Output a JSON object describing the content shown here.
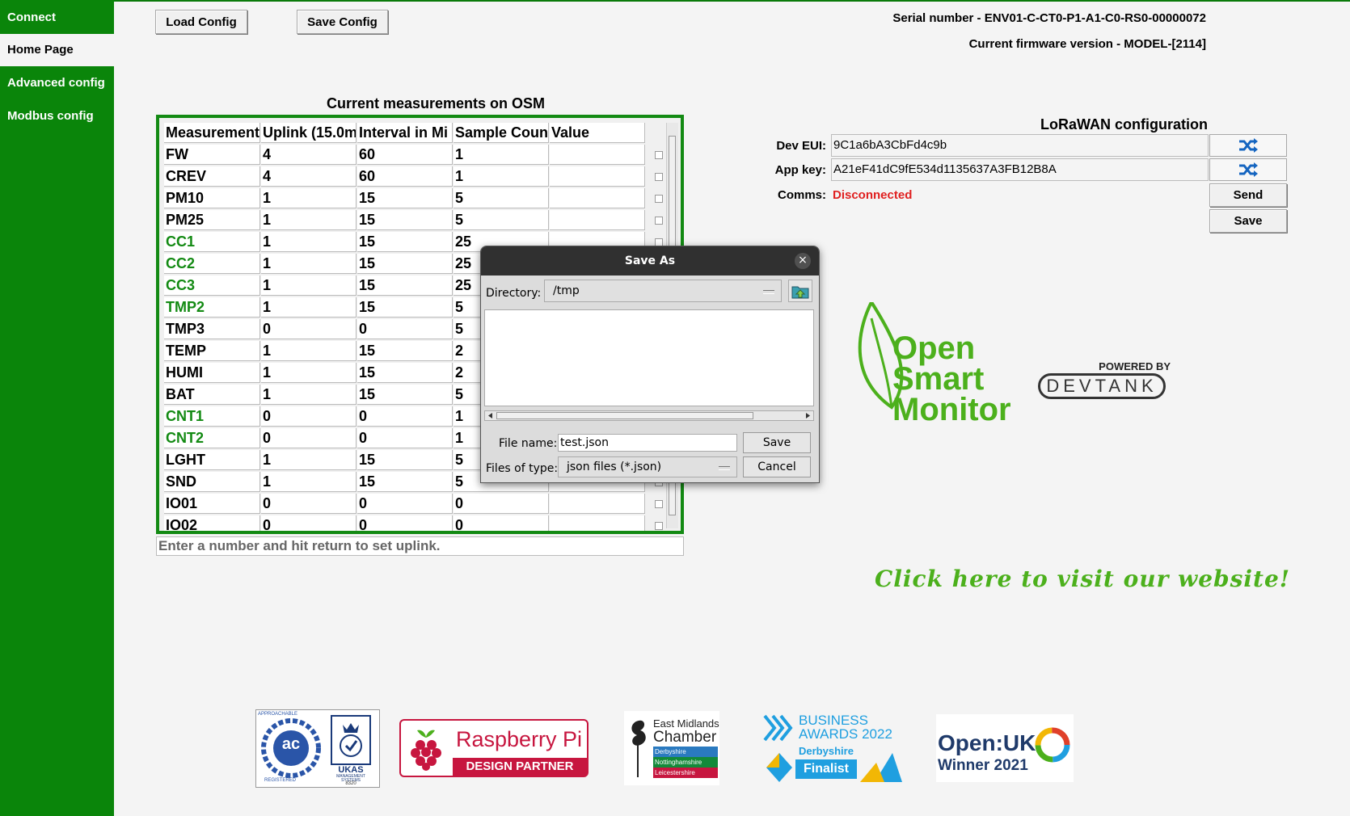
{
  "sidebar": {
    "items": [
      {
        "label": "Connect",
        "active": false
      },
      {
        "label": "Home Page",
        "active": true
      },
      {
        "label": "Advanced config",
        "active": false
      },
      {
        "label": "Modbus config",
        "active": false
      }
    ]
  },
  "toolbar": {
    "load_label": "Load Config",
    "save_label": "Save Config"
  },
  "device": {
    "serial": "Serial number - ENV01-C-CT0-P1-A1-C0-RS0-00000072",
    "firmware": "Current firmware version - MODEL-[2114]"
  },
  "measurements": {
    "title": "Current measurements on OSM",
    "columns": [
      "Measurement",
      "Uplink (15.0m",
      "Interval in Mi",
      "Sample Coun",
      "Value"
    ],
    "rows": [
      {
        "name": "FW",
        "uplink": "4",
        "interval": "60",
        "samples": "1",
        "value": "",
        "green": false
      },
      {
        "name": "CREV",
        "uplink": "4",
        "interval": "60",
        "samples": "1",
        "value": "",
        "green": false
      },
      {
        "name": "PM10",
        "uplink": "1",
        "interval": "15",
        "samples": "5",
        "value": "",
        "green": false
      },
      {
        "name": "PM25",
        "uplink": "1",
        "interval": "15",
        "samples": "5",
        "value": "",
        "green": false
      },
      {
        "name": "CC1",
        "uplink": "1",
        "interval": "15",
        "samples": "25",
        "value": "",
        "green": true
      },
      {
        "name": "CC2",
        "uplink": "1",
        "interval": "15",
        "samples": "25",
        "value": "",
        "green": true
      },
      {
        "name": "CC3",
        "uplink": "1",
        "interval": "15",
        "samples": "25",
        "value": "",
        "green": true
      },
      {
        "name": "TMP2",
        "uplink": "1",
        "interval": "15",
        "samples": "5",
        "value": "",
        "green": true
      },
      {
        "name": "TMP3",
        "uplink": "0",
        "interval": "0",
        "samples": "5",
        "value": "",
        "green": false
      },
      {
        "name": "TEMP",
        "uplink": "1",
        "interval": "15",
        "samples": "2",
        "value": "",
        "green": false
      },
      {
        "name": "HUMI",
        "uplink": "1",
        "interval": "15",
        "samples": "2",
        "value": "",
        "green": false
      },
      {
        "name": "BAT",
        "uplink": "1",
        "interval": "15",
        "samples": "5",
        "value": "",
        "green": false
      },
      {
        "name": "CNT1",
        "uplink": "0",
        "interval": "0",
        "samples": "1",
        "value": "",
        "green": true
      },
      {
        "name": "CNT2",
        "uplink": "0",
        "interval": "0",
        "samples": "1",
        "value": "",
        "green": true
      },
      {
        "name": "LGHT",
        "uplink": "1",
        "interval": "15",
        "samples": "5",
        "value": "",
        "green": false
      },
      {
        "name": "SND",
        "uplink": "1",
        "interval": "15",
        "samples": "5",
        "value": "",
        "green": false
      },
      {
        "name": "IO01",
        "uplink": "0",
        "interval": "0",
        "samples": "0",
        "value": "",
        "green": false
      },
      {
        "name": "IO02",
        "uplink": "0",
        "interval": "0",
        "samples": "0",
        "value": "",
        "green": false
      }
    ],
    "hint": "Enter a number and hit return to set uplink."
  },
  "lorawan": {
    "title": "LoRaWAN configuration",
    "dev_eui_label": "Dev EUI:",
    "dev_eui": "9C1a6bA3CbFd4c9b",
    "app_key_label": "App key:",
    "app_key": "A21eF41dC9fE534d1135637A3FB12B8A",
    "comms_label": "Comms:",
    "comms_status": "Disconnected",
    "send_label": "Send",
    "save_label": "Save",
    "status_color": "#e02020"
  },
  "dialog": {
    "title": "Save As",
    "close_glyph": "×",
    "directory_label": "Directory:",
    "directory": "/tmp",
    "filename_label": "File name:",
    "filename": "test.json",
    "filetype_label": "Files of type:",
    "filetype": "json files (*.json)",
    "save_label": "Save",
    "cancel_label": "Cancel"
  },
  "branding": {
    "osm_line1": "Open",
    "osm_line2": "Smart",
    "osm_line3": "Monitor",
    "powered_by": "POWERED BY",
    "devtank": "DEVTANK",
    "visit": "Click here to visit our website!",
    "accent": "#4cb01c"
  },
  "badges": {
    "ac_top": "APPROACHABLE",
    "ac_mid": "ac",
    "ac_bottom": "REGISTERED",
    "ukas": "UKAS",
    "ukas_sub1": "MANAGEMENT",
    "ukas_sub2": "SYSTEMS",
    "ukas_num": "8320",
    "rpi_title": "Raspberry Pi",
    "rpi_sub": "DESIGN PARTNER",
    "emc_line1": "East Midlands",
    "emc_line2": "Chamber",
    "emc_a": "Derbyshire",
    "emc_b": "Nottinghamshire",
    "emc_c": "Leicestershire",
    "ba_line1": "BUSINESS",
    "ba_line2": "AWARDS 2022",
    "ba_region": "Derbyshire",
    "ba_finalist": "Finalist",
    "ouk_line1": "Open",
    "ouk_uk": "UK",
    "ouk_line2": "Winner 2021"
  }
}
